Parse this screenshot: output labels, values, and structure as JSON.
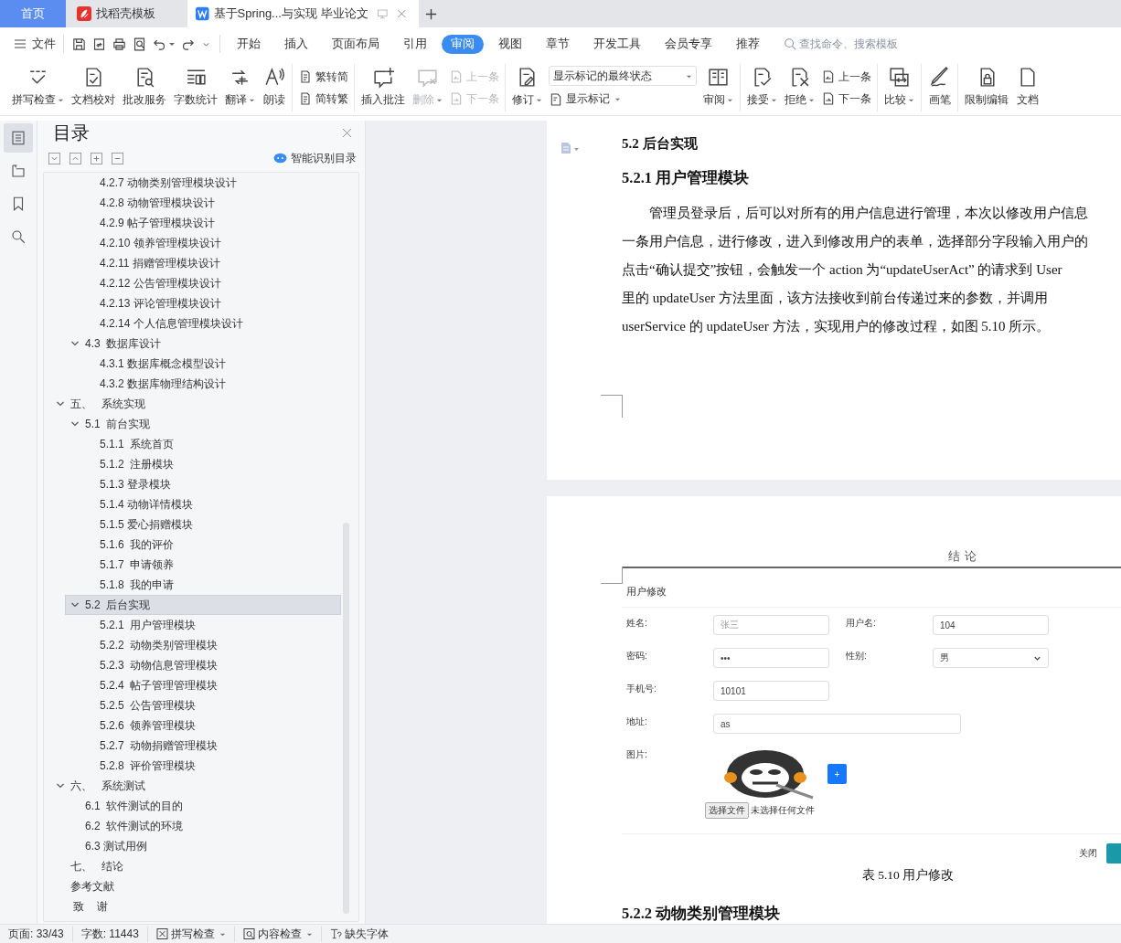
{
  "tabs": [
    {
      "kind": "home",
      "label": "首页",
      "selected": false
    },
    {
      "kind": "template",
      "label": "找稻壳模板",
      "selected": false
    },
    {
      "kind": "document",
      "label": "基于Spring...与实现 毕业论文",
      "selected": true
    }
  ],
  "menu": {
    "file": "文件",
    "tabs": [
      {
        "label": "开始",
        "selected": false
      },
      {
        "label": "插入",
        "selected": false
      },
      {
        "label": "页面布局",
        "selected": false
      },
      {
        "label": "引用",
        "selected": false
      },
      {
        "label": "审阅",
        "selected": true
      },
      {
        "label": "视图",
        "selected": false
      },
      {
        "label": "章节",
        "selected": false
      },
      {
        "label": "开发工具",
        "selected": false
      },
      {
        "label": "会员专享",
        "selected": false
      },
      {
        "label": "推荐",
        "selected": false
      }
    ],
    "search": {
      "placeholder": "查找命令、搜索模板"
    }
  },
  "ribbon": [
    [
      {
        "kind": "large",
        "label": "拼写检查",
        "caret": true,
        "disabled": false
      },
      {
        "kind": "large",
        "label": "文档校对",
        "caret": false,
        "disabled": false
      },
      {
        "kind": "large",
        "label": "批改服务",
        "caret": false,
        "disabled": false
      },
      {
        "kind": "large",
        "label": "字数统计",
        "caret": false,
        "disabled": false
      },
      {
        "kind": "large",
        "label": "翻译",
        "caret": true,
        "disabled": false
      },
      {
        "kind": "large",
        "label": "朗读",
        "caret": false,
        "disabled": false
      }
    ],
    [
      {
        "kind": "stack",
        "items": [
          {
            "label": "繁转简",
            "disabled": false
          },
          {
            "label": "简转繁",
            "disabled": false
          }
        ]
      }
    ],
    [
      {
        "kind": "large",
        "label": "插入批注",
        "caret": false,
        "disabled": false
      },
      {
        "kind": "large",
        "label": "删除",
        "caret": true,
        "disabled": true
      },
      {
        "kind": "stack",
        "items": [
          {
            "label": "上一条",
            "disabled": true
          },
          {
            "label": "下一条",
            "disabled": true
          }
        ]
      }
    ],
    [
      {
        "kind": "large",
        "label": "修订",
        "caret": true,
        "disabled": false
      },
      {
        "kind": "select",
        "value": "显示标记的最终状态",
        "below": {
          "label": "显示标记",
          "caret": true
        }
      },
      {
        "kind": "large",
        "label": "审阅",
        "caret": true,
        "disabled": false
      }
    ],
    [
      {
        "kind": "large",
        "label": "接受",
        "caret": true,
        "disabled": false
      },
      {
        "kind": "large",
        "label": "拒绝",
        "caret": true,
        "disabled": false
      },
      {
        "kind": "stack",
        "items": [
          {
            "label": "上一条",
            "disabled": false
          },
          {
            "label": "下一条",
            "disabled": false
          }
        ]
      }
    ],
    [
      {
        "kind": "large",
        "label": "比较",
        "caret": true,
        "disabled": false
      }
    ],
    [
      {
        "kind": "large",
        "label": "画笔",
        "caret": false,
        "disabled": false
      }
    ],
    [
      {
        "kind": "large",
        "label": "限制编辑",
        "caret": false,
        "disabled": false
      },
      {
        "kind": "large",
        "label": "文档",
        "caret": false,
        "disabled": false
      }
    ]
  ],
  "left_rail": [
    {
      "selected": true
    },
    {
      "selected": false
    },
    {
      "selected": false
    },
    {
      "selected": false
    }
  ],
  "toc": {
    "title": "目录",
    "smart_button": "智能识别目录",
    "items": [
      {
        "children": [
          {
            "children": [
              {
                "label": "4.2.7 动物类别管理模块设计",
                "selected": false
              },
              {
                "label": "4.2.8 动物管理模块设计",
                "selected": false
              },
              {
                "label": "4.2.9 帖子管理模块设计",
                "selected": false
              },
              {
                "label": "4.2.10 领养管理模块设计",
                "selected": false
              },
              {
                "label": "4.2.11 捐赠管理模块设计",
                "selected": false
              },
              {
                "label": "4.2.12 公告管理模块设计",
                "selected": false
              },
              {
                "label": "4.2.13 评论管理模块设计",
                "selected": false
              },
              {
                "label": "4.2.14 个人信息管理模块设计",
                "selected": false
              }
            ]
          },
          {
            "label": "4.3  数据库设计",
            "selected": false,
            "expanded": true,
            "children": [
              {
                "label": "4.3.1 数据库概念模型设计",
                "selected": false
              },
              {
                "label": "4.3.2 数据库物理结构设计",
                "selected": false
              }
            ]
          }
        ]
      },
      {
        "label": "五、   系统实现",
        "selected": false,
        "expanded": true,
        "children": [
          {
            "label": "5.1  前台实现",
            "selected": false,
            "expanded": true,
            "children": [
              {
                "label": "5.1.1  系统首页",
                "selected": false
              },
              {
                "label": "5.1.2  注册模块",
                "selected": false
              },
              {
                "label": "5.1.3 登录模块",
                "selected": false
              },
              {
                "label": "5.1.4 动物详情模块",
                "selected": false
              },
              {
                "label": "5.1.5 爱心捐赠模块",
                "selected": false
              },
              {
                "label": "5.1.6  我的评价",
                "selected": false
              },
              {
                "label": "5.1.7  申请领养",
                "selected": false
              },
              {
                "label": "5.1.8  我的申请",
                "selected": false
              }
            ]
          },
          {
            "label": "5.2  后台实现",
            "selected": true,
            "expanded": true,
            "children": [
              {
                "label": "5.2.1  用户管理模块",
                "selected": false
              },
              {
                "label": "5.2.2  动物类别管理模块",
                "selected": false
              },
              {
                "label": "5.2.3  动物信息管理模块",
                "selected": false
              },
              {
                "label": "5.2.4  帖子管理管理模块",
                "selected": false
              },
              {
                "label": "5.2.5  公告管理模块",
                "selected": false
              },
              {
                "label": "5.2.6  领养管理模块",
                "selected": false
              },
              {
                "label": "5.2.7  动物捐赠管理模块",
                "selected": false
              },
              {
                "label": "5.2.8  评价管理模块",
                "selected": false
              }
            ]
          }
        ]
      },
      {
        "label": "六、   系统测试",
        "selected": false,
        "expanded": true,
        "children": [
          {
            "label": "6.1  软件测试的目的",
            "selected": false
          },
          {
            "label": "6.2  软件测试的环境",
            "selected": false
          },
          {
            "label": "6.3 测试用例",
            "selected": false
          }
        ]
      },
      {
        "label": "七、   结论",
        "selected": false
      },
      {
        "label": "参考文献",
        "selected": false
      },
      {
        "label": " 致    谢",
        "selected": false
      }
    ]
  },
  "document": {
    "heading": "5.2  后台实现",
    "subheading": "5.2.1 用户管理模块",
    "paragraph": [
      "管理员登录后，后可以对所有的用户信息进行管理，本次以修改用户信息",
      "一条用户信息，进行修改，进入到修改用户的表单，选择部分字段输入用户的",
      "点击“确认提交”按钮，会触发一个 action 为“updateUserAct” 的请求到 User",
      "里的 updateUser 方法里面，该方法接收到前台传递过来的参数，并调用",
      "userService 的 updateUser 方法，实现用户的修改过程，如图 5.10 所示。"
    ],
    "page_header": "结  论",
    "figure": {
      "title": "用户修改",
      "rows": [
        [
          {
            "kind": "text",
            "label": "姓名:",
            "placeholder": "张三"
          },
          {
            "kind": "text",
            "label": "用户名:",
            "value": "104"
          }
        ],
        [
          {
            "kind": "password",
            "label": "密码:",
            "value": "•••"
          },
          {
            "kind": "select",
            "label": "性别:",
            "value": "男"
          }
        ],
        [
          {
            "kind": "text",
            "label": "手机号:",
            "value": "10101"
          }
        ],
        [
          {
            "kind": "wide",
            "label": "地址:",
            "value": "as"
          }
        ],
        [
          {
            "kind": "image",
            "label": "图片:",
            "add_button": "+",
            "file_button": "选择文件",
            "file_status": "未选择任何文件"
          }
        ]
      ],
      "close": "关闭"
    },
    "caption": "表 5.10  用户修改",
    "next_heading": "5.2.2  动物类别管理模块"
  },
  "status_bar": {
    "page": "页面: 33/43",
    "words": "字数: 11443",
    "spell": "拼写检查",
    "content": "内容检查",
    "fonts": "缺失字体"
  }
}
